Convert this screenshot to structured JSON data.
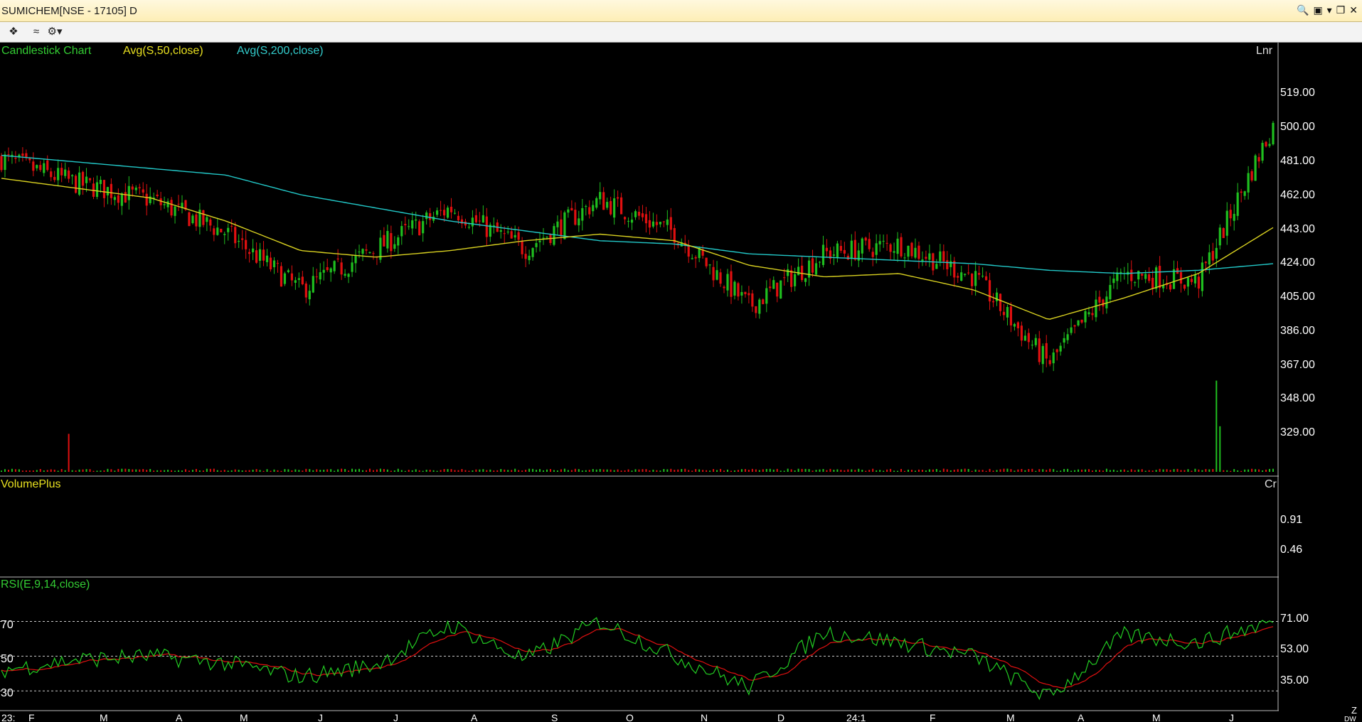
{
  "window": {
    "title": "SUMICHEM[NSE - 17105] D"
  },
  "icons": {
    "search": "search-icon",
    "profile": "profile-icon",
    "dropdown": "chevron-down-icon",
    "restore": "restore-icon",
    "close": "close-icon",
    "crosshair": "crosshair-icon",
    "line_chart": "line-chart-icon",
    "settings": "gear-icon"
  },
  "colors": {
    "background": "#000000",
    "up_candle": "#1fbf1f",
    "down_candle": "#e01010",
    "ma50": "#d8d020",
    "ma200": "#22c8c8",
    "rsi": "#22cc22",
    "rsi_signal": "#e01010",
    "label_green": "#33cc33",
    "label_yellow": "#e8e020",
    "label_cyan": "#33cccc"
  },
  "price_panel": {
    "legend": {
      "chart": "Candlestick Chart",
      "ma1": "Avg(S,50,close)",
      "ma2": "Avg(S,200,close)"
    },
    "scale_tag": "Lnr",
    "ticks": [
      "519.00",
      "500.00",
      "481.00",
      "462.00",
      "443.00",
      "424.00",
      "405.00",
      "386.00",
      "367.00",
      "348.00",
      "329.00"
    ]
  },
  "volume_panel": {
    "label": "VolumePlus",
    "scale_tag": "Cr",
    "ticks": [
      "0.91",
      "0.46"
    ]
  },
  "rsi_panel": {
    "label": "RSI(E,9,14,close)",
    "left_levels": [
      "70",
      "50",
      "30"
    ],
    "ticks": [
      "71.00",
      "53.00",
      "35.00"
    ]
  },
  "time_axis": {
    "labels": [
      "23:",
      "F",
      "M",
      "A",
      "M",
      "J",
      "J",
      "A",
      "S",
      "O",
      "N",
      "D",
      "24:1",
      "F",
      "M",
      "A",
      "M",
      "J"
    ]
  },
  "corner": {
    "z": "Z",
    "dw": "DW"
  },
  "chart_data": {
    "type": "candlestick",
    "timeframe": "D",
    "ylim": [
      320,
      530
    ],
    "price_anchors": [
      {
        "month": "Jan-23",
        "value": 470
      },
      {
        "month": "Feb-23",
        "value": 455
      },
      {
        "month": "Mar-23",
        "value": 445
      },
      {
        "month": "Apr-23",
        "value": 425
      },
      {
        "month": "May-23",
        "value": 390
      },
      {
        "month": "Jun-23",
        "value": 415
      },
      {
        "month": "Jul-23",
        "value": 440
      },
      {
        "month": "Aug-23",
        "value": 415
      },
      {
        "month": "Sep-23",
        "value": 445
      },
      {
        "month": "Oct-23",
        "value": 425
      },
      {
        "month": "Nov-23",
        "value": 380
      },
      {
        "month": "Dec-23",
        "value": 412
      },
      {
        "month": "Jan-24",
        "value": 418
      },
      {
        "month": "Feb-24",
        "value": 398
      },
      {
        "month": "Mar-24",
        "value": 345
      },
      {
        "month": "Apr-24",
        "value": 400
      },
      {
        "month": "May-24",
        "value": 395
      },
      {
        "month": "Jun-24",
        "value": 490
      }
    ],
    "ma50_anchors": [
      458,
      452,
      446,
      432,
      414,
      410,
      414,
      420,
      424,
      420,
      405,
      398,
      400,
      390,
      372,
      385,
      400,
      428
    ],
    "ma200_anchors": [
      472,
      468,
      464,
      460,
      448,
      440,
      432,
      426,
      420,
      418,
      412,
      410,
      408,
      406,
      402,
      400,
      402,
      406
    ],
    "volume_ylim": [
      0,
      1.2
    ],
    "volume_spikes": [
      {
        "month": "Feb-23",
        "value": 0.5
      },
      {
        "month": "Jun-24",
        "value": 1.2
      }
    ],
    "rsi_ylim": [
      20,
      85
    ],
    "rsi_levels": [
      70,
      50,
      30
    ],
    "rsi_anchors": [
      42,
      48,
      50,
      46,
      38,
      45,
      68,
      48,
      70,
      50,
      32,
      64,
      58,
      50,
      26,
      62,
      58,
      70
    ]
  }
}
